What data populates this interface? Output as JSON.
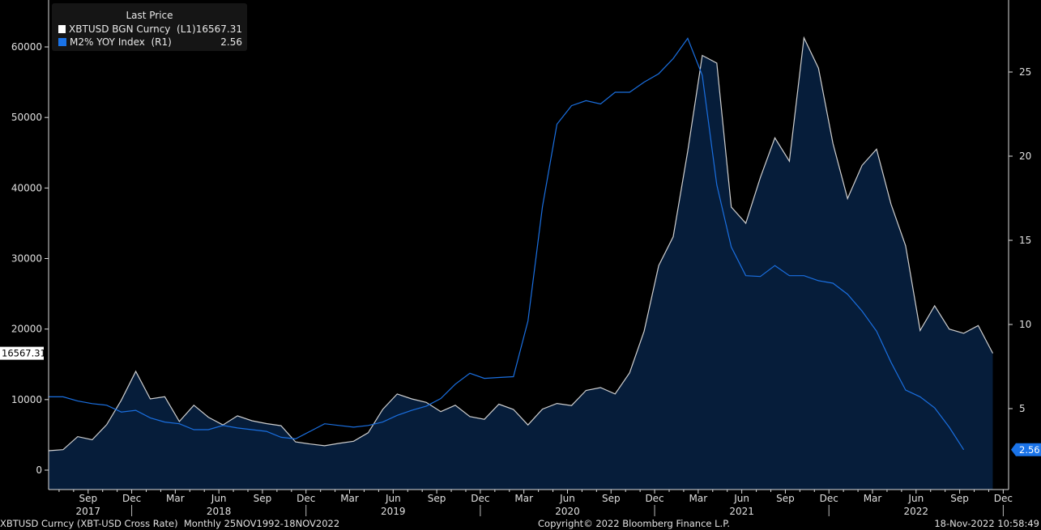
{
  "chart_data": {
    "type": "line",
    "title": "",
    "legend": {
      "title": "Last Price",
      "placement": "top-left",
      "entries": [
        {
          "name": "XBTUSD BGN Curncy  (L1)",
          "last": "16567.31",
          "color": "#ffffff"
        },
        {
          "name": "M2% YOY Index  (R1)",
          "last": "2.56",
          "color": "#1a73e8"
        }
      ]
    },
    "x_start": "Jun 2017",
    "x_end": "Nov 2022",
    "frequency": "Monthly",
    "series": [
      {
        "name": "XBTUSD BGN Curncy",
        "axis": "left",
        "style": "area",
        "color": "#d0d0d0",
        "fill": "#061d3a",
        "values": [
          2750,
          2900,
          4750,
          4300,
          6450,
          9900,
          14000,
          10100,
          10400,
          6900,
          9200,
          7500,
          6400,
          7700,
          7000,
          6600,
          6300,
          4000,
          3700,
          3450,
          3800,
          4100,
          5300,
          8600,
          10800,
          10100,
          9600,
          8300,
          9200,
          7600,
          7200,
          9350,
          8600,
          6400,
          8650,
          9450,
          9150,
          11300,
          11700,
          10800,
          13800,
          19700,
          29000,
          33100,
          45200,
          58800,
          57700,
          37300,
          35000,
          41500,
          47100,
          43800,
          61300,
          57000,
          46300,
          38500,
          43200,
          45500,
          37700,
          31800,
          19800,
          23300,
          20000,
          19400,
          20500,
          16567.31
        ]
      },
      {
        "name": "M2% YOY Index",
        "axis": "right",
        "style": "line",
        "color": "#1a6fe0",
        "values": [
          5.7,
          5.7,
          5.45,
          5.3,
          5.2,
          4.8,
          4.9,
          4.45,
          4.2,
          4.1,
          3.75,
          3.75,
          4.0,
          3.85,
          3.75,
          3.65,
          3.3,
          3.2,
          3.65,
          4.1,
          4.0,
          3.9,
          4.0,
          4.2,
          4.6,
          4.9,
          5.15,
          5.6,
          6.45,
          7.1,
          6.8,
          6.85,
          6.9,
          10.2,
          17.0,
          21.9,
          23.0,
          23.3,
          23.1,
          23.8,
          23.8,
          24.4,
          24.9,
          25.8,
          27.0,
          24.8,
          18.3,
          14.6,
          12.9,
          12.85,
          13.5,
          12.9,
          12.9,
          12.6,
          12.45,
          11.8,
          10.8,
          9.6,
          7.75,
          6.1,
          5.7,
          5.05,
          3.9,
          2.56
        ]
      }
    ],
    "y_left": {
      "ylim": [
        -2800,
        63000
      ],
      "ticks": [
        0,
        10000,
        20000,
        30000,
        40000,
        50000,
        60000
      ],
      "last_tag": "16567.31"
    },
    "y_right": {
      "ylim": [
        1.6,
        28.4
      ],
      "ticks": [
        5,
        10,
        15,
        20,
        25
      ],
      "last_tag": "2.56"
    },
    "x_ticks": [
      {
        "label": "Sep",
        "i": 3
      },
      {
        "label": "Dec",
        "i": 6
      },
      {
        "label": "Mar",
        "i": 9
      },
      {
        "label": "Jun",
        "i": 12
      },
      {
        "label": "Sep",
        "i": 15
      },
      {
        "label": "Dec",
        "i": 18
      },
      {
        "label": "Mar",
        "i": 21
      },
      {
        "label": "Jun",
        "i": 24
      },
      {
        "label": "Sep",
        "i": 27
      },
      {
        "label": "Dec",
        "i": 30
      },
      {
        "label": "Mar",
        "i": 33
      },
      {
        "label": "Jun",
        "i": 36
      },
      {
        "label": "Sep",
        "i": 39
      },
      {
        "label": "Dec",
        "i": 42
      },
      {
        "label": "Mar",
        "i": 45
      },
      {
        "label": "Jun",
        "i": 48
      },
      {
        "label": "Sep",
        "i": 51
      },
      {
        "label": "Dec",
        "i": 54
      },
      {
        "label": "Mar",
        "i": 57
      },
      {
        "label": "Jun",
        "i": 60
      },
      {
        "label": "Sep",
        "i": 63
      },
      {
        "label": "Dec",
        "i": 66
      }
    ],
    "x_years": [
      {
        "label": "2017",
        "i": 3
      },
      {
        "label": "2018",
        "i": 12
      },
      {
        "label": "2019",
        "i": 24
      },
      {
        "label": "2020",
        "i": 36
      },
      {
        "label": "2021",
        "i": 48
      },
      {
        "label": "2022",
        "i": 60
      }
    ],
    "grid": false
  },
  "footer": {
    "left": "XBTUSD Curncy (XBT-USD Cross Rate)  Monthly 25NOV1992-18NOV2022",
    "center": "Copyright© 2022 Bloomberg Finance L.P.",
    "right": "18-Nov-2022 10:58:49"
  }
}
